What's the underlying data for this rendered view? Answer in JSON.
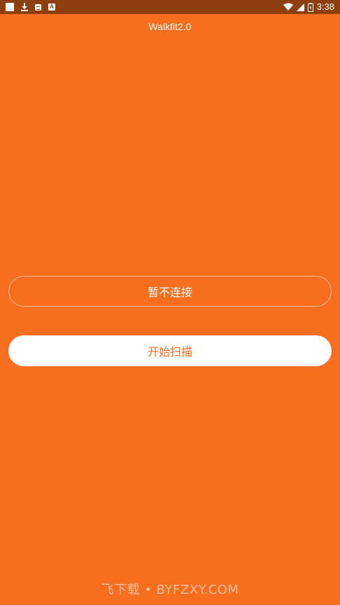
{
  "status_bar": {
    "time": "3:38",
    "icons": [
      "notification-square-icon",
      "download-icon",
      "sim-card-icon",
      "a-icon",
      "wifi-icon",
      "signal-icon",
      "battery-icon"
    ]
  },
  "app": {
    "title": "Walkfit2.0"
  },
  "buttons": {
    "skip_label": "暂不连接",
    "scan_label": "开始扫描"
  },
  "watermark": {
    "text": "飞下载 • BYFZXY.COM"
  },
  "colors": {
    "background": "#F86E1F",
    "status_bar": "#8E3F0F",
    "primary_text_on_white": "#F86E1F"
  }
}
